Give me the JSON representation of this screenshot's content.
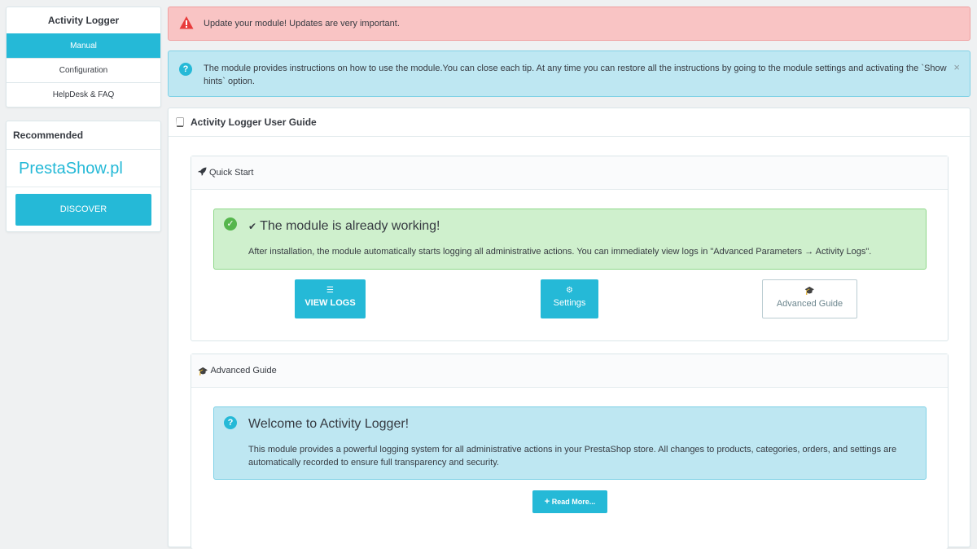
{
  "sidebar": {
    "title": "Activity Logger",
    "items": [
      {
        "label": "Manual",
        "active": true
      },
      {
        "label": "Configuration",
        "active": false
      },
      {
        "label": "HelpDesk & FAQ",
        "active": false
      }
    ],
    "recommended": {
      "title": "Recommended",
      "brand": "PrestaShow.pl",
      "button": "DISCOVER"
    }
  },
  "alerts": {
    "danger": "Update your module! Updates are very important.",
    "info": "The module provides instructions on how to use the module.You can close each tip. At any time you can restore all the instructions by going to the module settings and activating the `Show hints` option.",
    "close": "×"
  },
  "guide": {
    "title": "Activity Logger User Guide",
    "quick_start": {
      "header": "Quick Start",
      "success_title": "The module is already working!",
      "success_text": "After installation, the module automatically starts logging all administrative actions. You can immediately view logs in \"Advanced Parameters → Activity Logs\".",
      "buttons": {
        "view_logs": "VIEW LOGS",
        "settings": "Settings",
        "advanced": "Advanced Guide"
      }
    },
    "advanced": {
      "header": "Advanced Guide",
      "info_title": "Welcome to Activity Logger!",
      "info_text": "This module provides a powerful logging system for all administrative actions in your PrestaShop store. All changes to products, categories, orders, and settings are automatically recorded to ensure full transparency and security.",
      "read_more": "Read More..."
    }
  },
  "colors": {
    "accent": "#25b9d7",
    "danger_bg": "#f9c4c4",
    "info_bg": "#bee7f2",
    "success_bg": "#cff0cd"
  }
}
